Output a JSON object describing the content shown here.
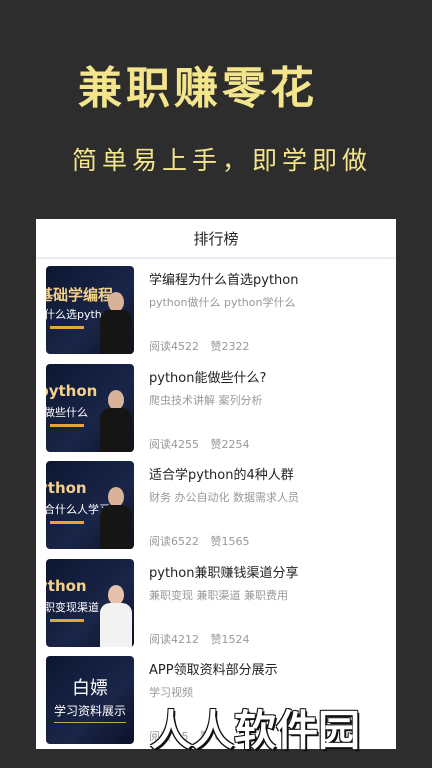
{
  "promo": {
    "title": "兼职赚零花",
    "subtitle": "简单易上手，即学即做"
  },
  "screen": {
    "header_title": "排行榜"
  },
  "articles": [
    {
      "title": "学编程为什么首选python",
      "tags": "python做什么 python学什么",
      "reads_label": "阅读4522",
      "likes_label": "赞2322",
      "thumb_line1": "基础学编程",
      "thumb_line2": "什么选python"
    },
    {
      "title": "python能做些什么?",
      "tags": "爬虫技术讲解 案列分析",
      "reads_label": "阅读4255",
      "likes_label": "赞2254",
      "thumb_line1": "python",
      "thumb_line2": "做些什么"
    },
    {
      "title": "适合学python的4种人群",
      "tags": "财务 办公自动化 数据需求人员",
      "reads_label": "阅读6522",
      "likes_label": "赞1565",
      "thumb_line1": "ython",
      "thumb_line2": "合什么人学习"
    },
    {
      "title": "python兼职赚钱渠道分享",
      "tags": "兼职变现 兼职渠道 兼职费用",
      "reads_label": "阅读4212",
      "likes_label": "赞1524",
      "thumb_line1": "ython",
      "thumb_line2": "职变现渠道"
    },
    {
      "title": "APP领取资料部分展示",
      "tags": "学习视频",
      "reads_label": "阅读    05",
      "likes_label": "赞    0",
      "thumb_line1": "白嫖",
      "thumb_line2": "学习资料展示"
    }
  ],
  "watermark": "人人软件园"
}
